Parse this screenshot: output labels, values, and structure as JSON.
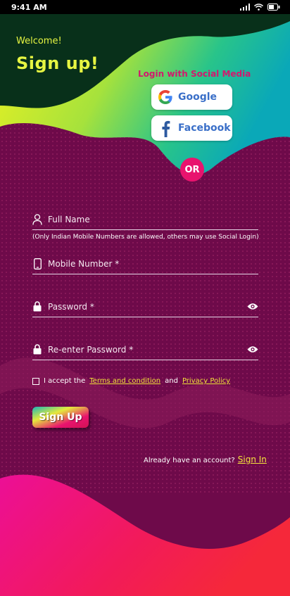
{
  "statusbar": {
    "time": "9:41 AM"
  },
  "header": {
    "welcome": "Welcome!",
    "title": "Sign up!"
  },
  "social": {
    "label": "Login with Social Media",
    "google": "Google",
    "facebook": "Facebook",
    "or": "OR"
  },
  "form": {
    "full_name_placeholder": "Full Name",
    "hint": "(Only Indian Mobile Numbers are allowed, others may use Social Login)",
    "mobile_placeholder": "Mobile Number *",
    "password_placeholder": "Password *",
    "reenter_placeholder": "Re-enter Password *",
    "accept_prefix": "I accept the",
    "terms_link": "Terms and condition",
    "accept_and": "and",
    "privacy_link": "Privacy Policy",
    "signup_button": "Sign Up",
    "already_text": "Already have an account?",
    "signin_link": "Sign In"
  },
  "colors": {
    "background": "#6e0a4a",
    "header_dark": "#08301a",
    "accent_yellow": "#e6f542",
    "accent_pink": "#e8136e",
    "link_yellow": "#f3e13b",
    "social_text": "#3a6fc8"
  },
  "icons": [
    "person-icon",
    "phone-icon",
    "lock-icon",
    "eye-icon",
    "google-logo-icon",
    "facebook-logo-icon",
    "signal-icon",
    "wifi-icon",
    "battery-icon"
  ]
}
